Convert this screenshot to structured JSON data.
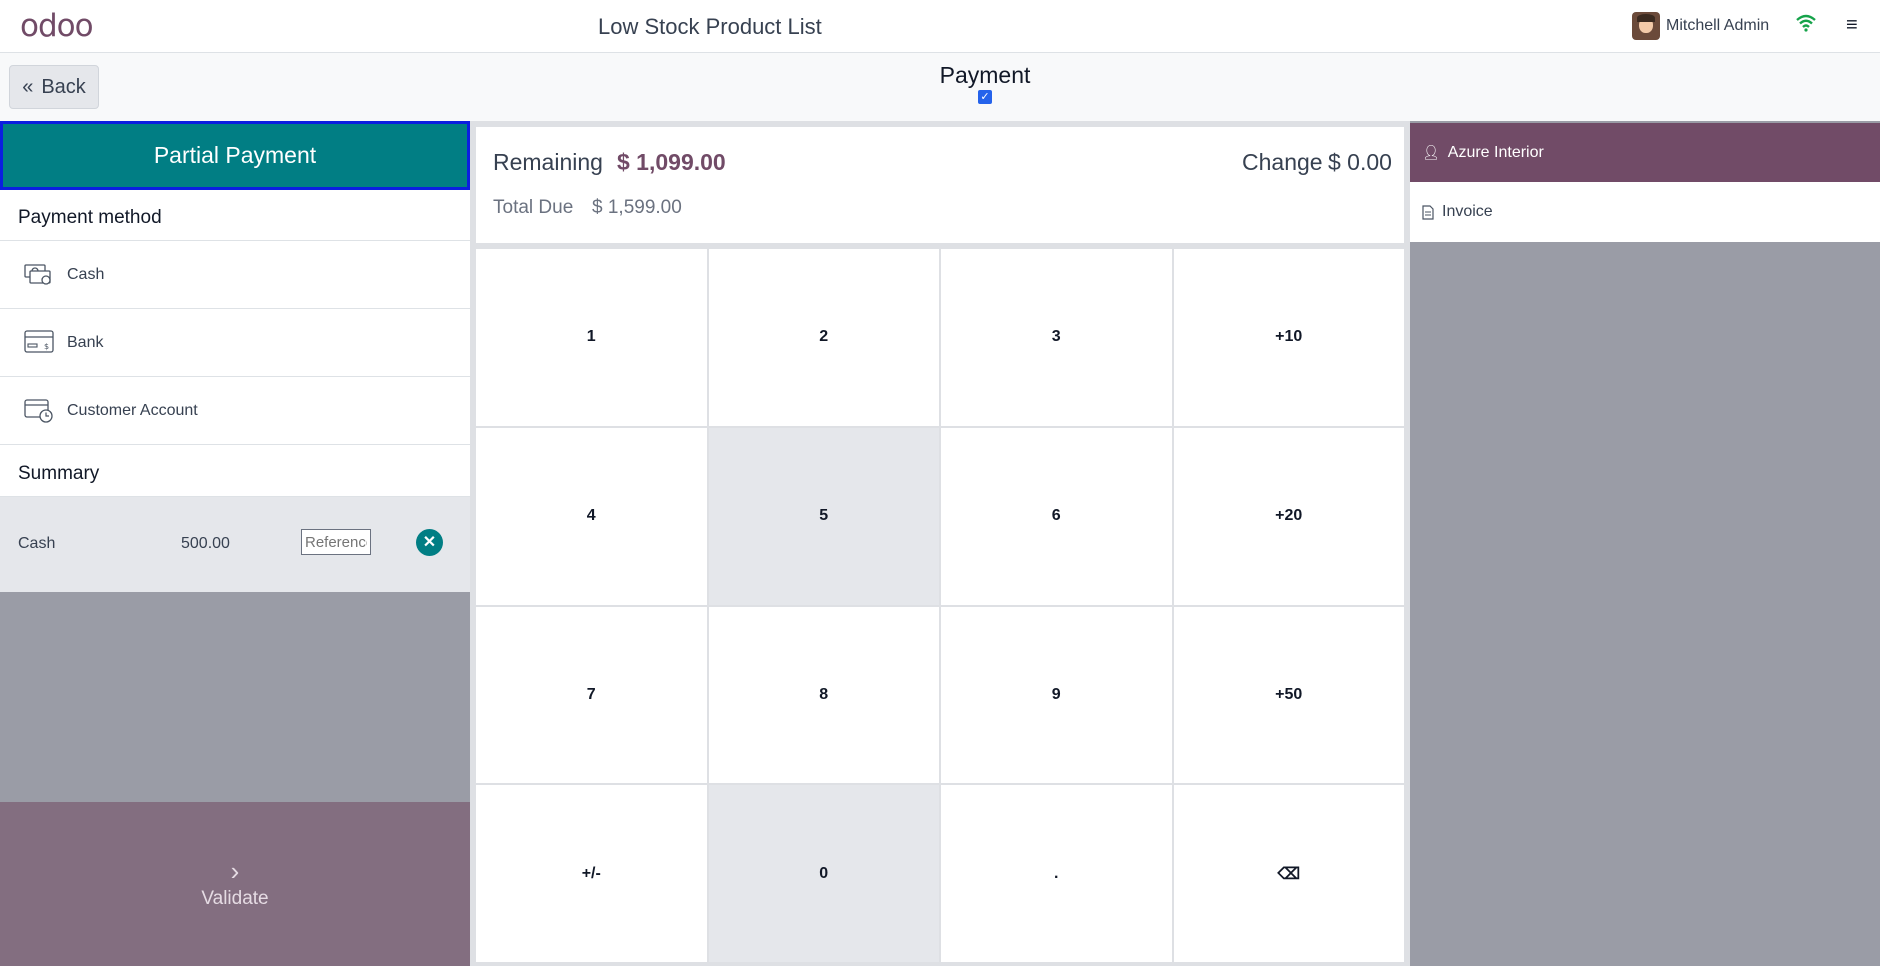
{
  "header": {
    "logo": "odoo",
    "store_title": "Low Stock Product List",
    "user_name": "Mitchell Admin"
  },
  "subheader": {
    "back_label": "Back",
    "title": "Payment"
  },
  "left": {
    "partial_payment_label": "Partial Payment",
    "payment_method_title": "Payment method",
    "methods": [
      {
        "label": "Cash",
        "icon": "cash-icon"
      },
      {
        "label": "Bank",
        "icon": "bank-card-icon"
      },
      {
        "label": "Customer Account",
        "icon": "customer-account-icon"
      }
    ],
    "summary_title": "Summary",
    "summary_lines": [
      {
        "method": "Cash",
        "amount": "500.00",
        "reference_placeholder": "Reference"
      }
    ],
    "validate_label": "Validate"
  },
  "middle": {
    "remaining_label": "Remaining",
    "remaining_value": "$ 1,099.00",
    "change_label": "Change",
    "change_value": "$ 0.00",
    "total_due_label": "Total Due",
    "total_due_value": "$ 1,599.00",
    "keys": [
      "1",
      "2",
      "3",
      "+10",
      "4",
      "5",
      "6",
      "+20",
      "7",
      "8",
      "9",
      "+50",
      "+/-",
      "0",
      ".",
      "⌫"
    ]
  },
  "right": {
    "customer_name": "Azure Interior",
    "invoice_label": "Invoice"
  },
  "colors": {
    "teal": "#017e84",
    "purple": "#714b67",
    "validate_bg": "#836e80",
    "gray_panel": "#9a9ca6"
  }
}
